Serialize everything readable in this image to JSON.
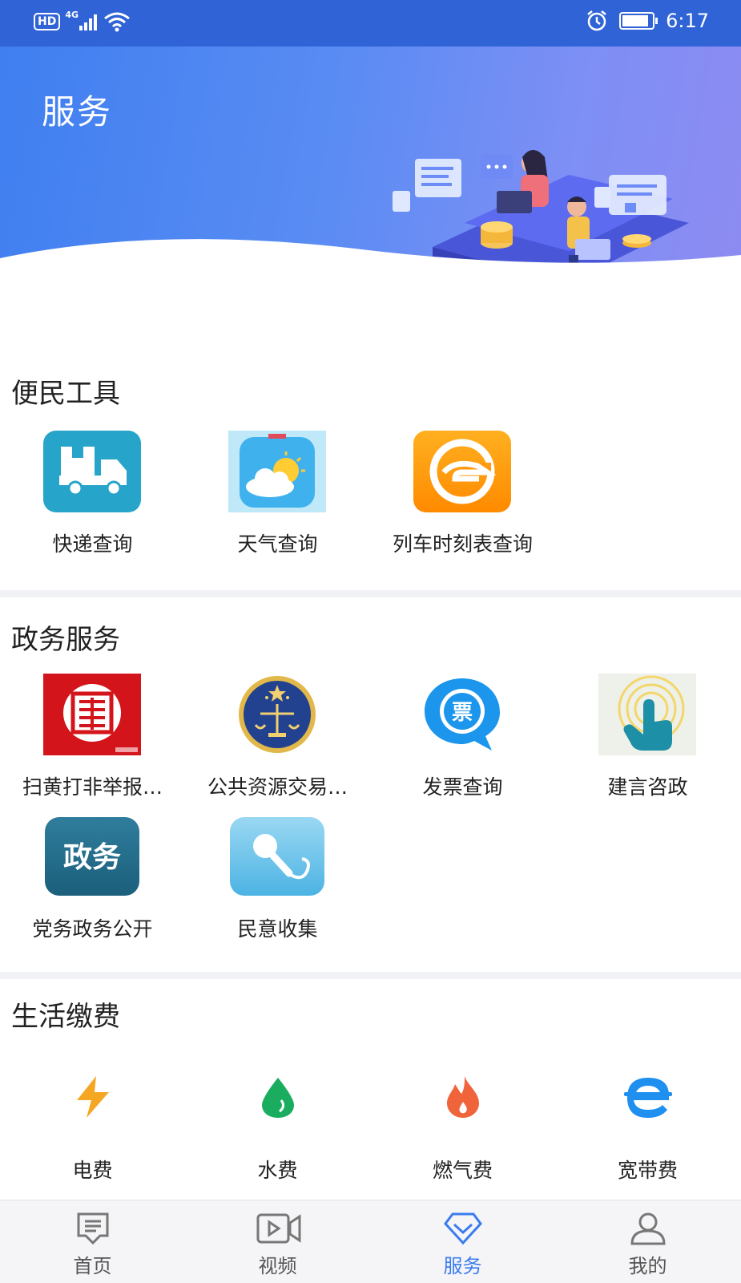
{
  "status_bar": {
    "hd": "HD",
    "network": "4G",
    "time": "6:17",
    "battery_level": 0.9
  },
  "header": {
    "title": "服务"
  },
  "sections": {
    "convenience": {
      "title": "便民工具",
      "items": [
        {
          "label": "快递查询",
          "icon": "truck-icon"
        },
        {
          "label": "天气查询",
          "icon": "weather-icon"
        },
        {
          "label": "列车时刻表查询",
          "icon": "train-icon"
        }
      ]
    },
    "government": {
      "title": "政务服务",
      "items": [
        {
          "label": "扫黄打非举报…",
          "icon": "anti-porn-report-icon"
        },
        {
          "label": "公共资源交易…",
          "icon": "public-resource-emblem-icon"
        },
        {
          "label": "发票查询",
          "icon": "invoice-icon",
          "glyph": "票"
        },
        {
          "label": "建言咨政",
          "icon": "finger-touch-icon"
        },
        {
          "label": "党务政务公开",
          "icon": "government-affairs-icon",
          "glyph": "政务"
        },
        {
          "label": "民意收集",
          "icon": "microphone-icon"
        }
      ]
    },
    "payments": {
      "title": "生活缴费",
      "items": [
        {
          "label": "电费",
          "icon": "lightning-icon",
          "color": "#f5a623"
        },
        {
          "label": "水费",
          "icon": "water-drop-icon",
          "color": "#1aad5f"
        },
        {
          "label": "燃气费",
          "icon": "flame-icon",
          "color": "#f0643c"
        },
        {
          "label": "宽带费",
          "icon": "broadband-e-icon",
          "color": "#1f8ff0"
        }
      ]
    }
  },
  "tabbar": {
    "tabs": [
      {
        "label": "首页",
        "icon": "home-doc-icon"
      },
      {
        "label": "视频",
        "icon": "video-icon"
      },
      {
        "label": "服务",
        "icon": "service-diamond-icon"
      },
      {
        "label": "我的",
        "icon": "user-icon"
      }
    ],
    "active_index": 2,
    "active_color": "#3a7bf0"
  }
}
